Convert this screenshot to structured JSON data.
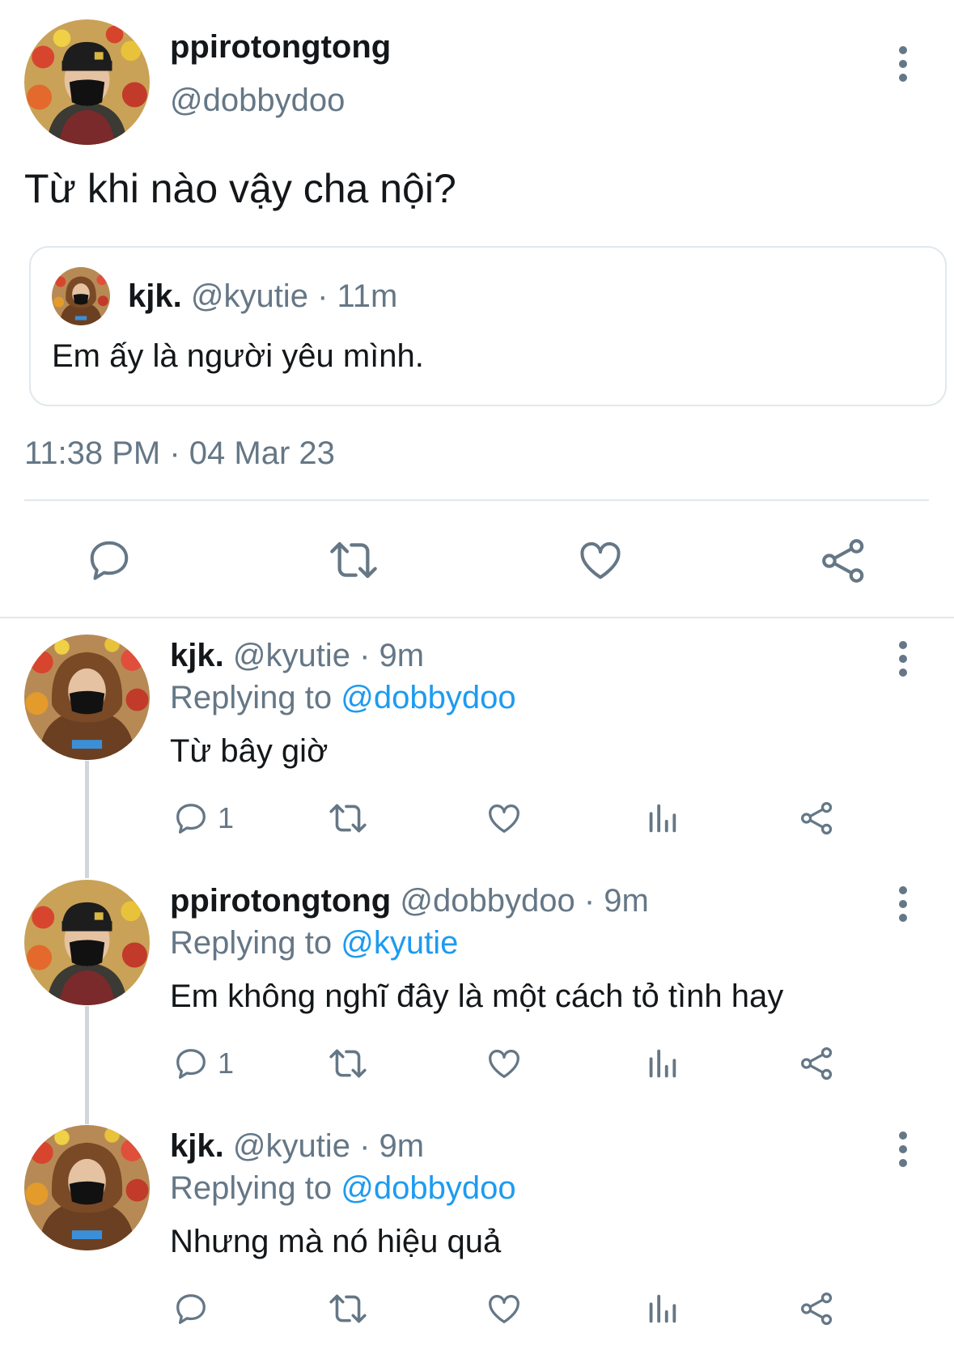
{
  "main_tweet": {
    "display_name": "ppirotongtong",
    "handle": "@dobbydoo",
    "text": "Từ khi nào vậy cha nội?",
    "timestamp": "11:38 PM · 04 Mar 23",
    "avatar_icon": "avatar-photo-black-beanie-mask",
    "more_icon": "more-vertical-icon"
  },
  "quoted_tweet": {
    "display_name": "kjk.",
    "handle": "@kyutie",
    "time": "· 11m",
    "text": "Em ấy là người yêu mình.",
    "avatar_icon": "avatar-photo-brown-hoodie-mask"
  },
  "main_actions": {
    "icons": [
      "reply-icon",
      "retweet-icon",
      "like-icon",
      "share-icon"
    ]
  },
  "replies": [
    {
      "display_name": "kjk.",
      "handle": "@kyutie",
      "time": "· 9m",
      "replying_label": "Replying to",
      "replying_to": "@dobbydoo",
      "text": "Từ bây giờ",
      "reply_count": "1"
    },
    {
      "display_name": "ppirotongtong",
      "handle": "@dobbydoo",
      "time": "· 9m",
      "replying_label": "Replying to",
      "replying_to": "@kyutie",
      "text": "Em không nghĩ đây là một cách tỏ tình hay",
      "reply_count": "1"
    },
    {
      "display_name": "kjk.",
      "handle": "@kyutie",
      "time": "· 9m",
      "replying_label": "Replying to",
      "replying_to": "@dobbydoo",
      "text": "Nhưng mà nó hiệu quả",
      "reply_count": ""
    }
  ],
  "colors": {
    "text": "#14171a",
    "secondary": "#657786",
    "link": "#1d9bf0",
    "border": "#e1e8ed"
  }
}
